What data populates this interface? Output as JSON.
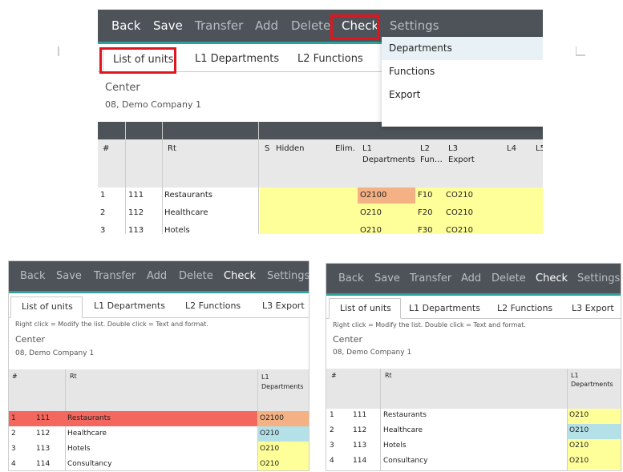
{
  "toolbar": {
    "back": "Back",
    "save": "Save",
    "transfer": "Transfer",
    "add": "Add",
    "delete": "Delete",
    "check": "Check",
    "settings": "Settings"
  },
  "tabs": {
    "units": "List of units",
    "l1": "L1 Departments",
    "l2": "L2 Functions",
    "l3": "L3 Export"
  },
  "hint": "Right click = Modify the list. Double click = Text and format.",
  "center": {
    "label": "Center",
    "value": "08, Demo Company 1"
  },
  "dropdown": {
    "items": [
      "Departments",
      "Functions",
      "Export"
    ]
  },
  "top_grid": {
    "headers": {
      "num": "#",
      "rt": "Rt",
      "s": "S",
      "hidden": "Hidden",
      "elim": "Elim.",
      "l1a": "L1",
      "l1b": "Departments",
      "l2a": "L2",
      "l2b": "Fun…",
      "l3a": "L3",
      "l3b": "Export",
      "l4": "L4",
      "l5": "L5"
    },
    "rows": [
      {
        "n": "1",
        "code": "111",
        "name": "Restaurants",
        "l1": "O2100",
        "l2": "F10",
        "l3": "CO210"
      },
      {
        "n": "2",
        "code": "112",
        "name": "Healthcare",
        "l1": "O210",
        "l2": "F20",
        "l3": "CO210"
      },
      {
        "n": "3",
        "code": "113",
        "name": "Hotels",
        "l1": "O210",
        "l2": "F30",
        "l3": "CO210"
      }
    ]
  },
  "bottom_grid": {
    "headers": {
      "num": "#",
      "rt": "Rt",
      "l1a": "L1",
      "l1b": "Departments"
    },
    "rows_left": [
      {
        "n": "1",
        "code": "111",
        "name": "Restaurants",
        "l1": "O2100"
      },
      {
        "n": "2",
        "code": "112",
        "name": "Healthcare",
        "l1": "O210"
      },
      {
        "n": "3",
        "code": "113",
        "name": "Hotels",
        "l1": "O210"
      },
      {
        "n": "4",
        "code": "114",
        "name": "Consultancy",
        "l1": "O210"
      }
    ],
    "rows_right": [
      {
        "n": "1",
        "code": "111",
        "name": "Restaurants",
        "l1": "O210"
      },
      {
        "n": "2",
        "code": "112",
        "name": "Healthcare",
        "l1": "O210"
      },
      {
        "n": "3",
        "code": "113",
        "name": "Hotels",
        "l1": "O210"
      },
      {
        "n": "4",
        "code": "114",
        "name": "Consultancy",
        "l1": "O210"
      }
    ]
  },
  "colors": {
    "toolbar": "#4d5359",
    "teal": "#2ea19a",
    "yellow": "#ffff99",
    "orange": "#f4b183",
    "red_row": "#f4675f",
    "light_blue": "#b4e0e8",
    "highlight": "#e0161e"
  }
}
